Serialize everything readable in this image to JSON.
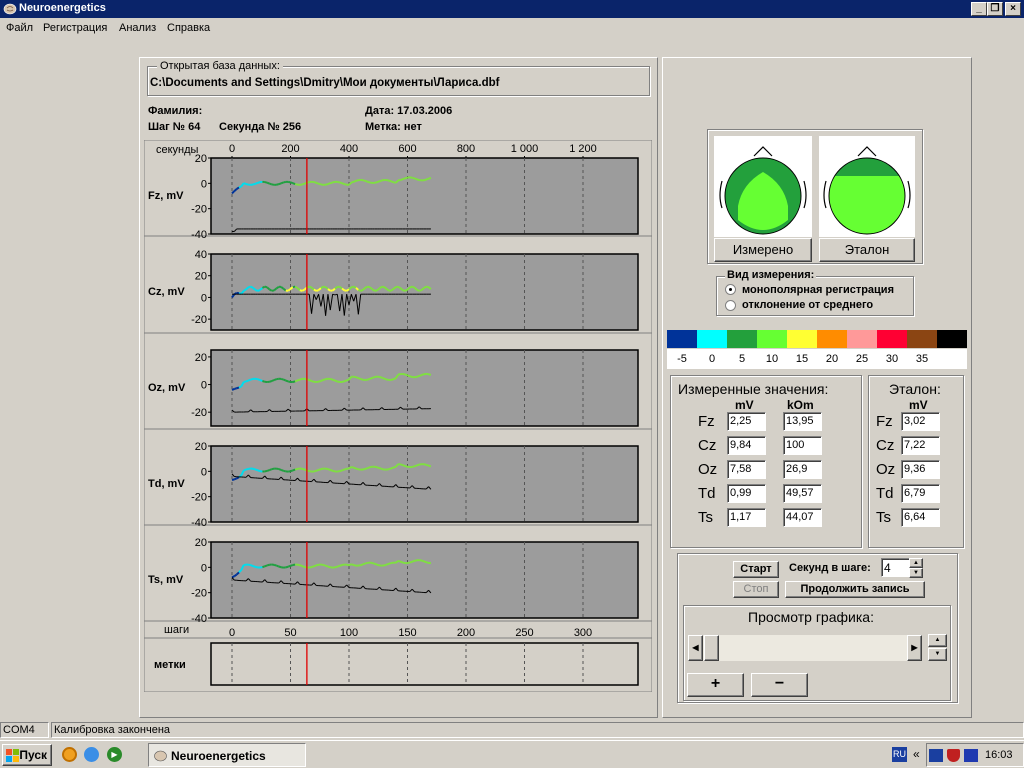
{
  "window": {
    "title": "Neuroenergetics",
    "min": "_",
    "max": "❐",
    "close": "×"
  },
  "menu": [
    "Файл",
    "Регистрация",
    "Анализ",
    "Справка"
  ],
  "database": {
    "label": "Открытая база данных:",
    "path": "C:\\Documents and Settings\\Dmitry\\Мои документы\\Лариса.dbf"
  },
  "info": {
    "surname": "Фамилия:",
    "step": "Шаг № 64",
    "second": "Секунда № 256",
    "date": "Дата: 17.03.2006",
    "mark": "Метка: нет"
  },
  "axis": {
    "top_label": "секунды",
    "top_ticks": [
      "0",
      "200",
      "400",
      "600",
      "800",
      "1 000",
      "1 200"
    ],
    "bottom_label": "шаги",
    "bottom_ticks": [
      "0",
      "50",
      "100",
      "150",
      "200",
      "250",
      "300"
    ]
  },
  "chart_data": [
    {
      "type": "line",
      "name": "Fz, mV",
      "yticks": [
        "20",
        "0",
        "-20",
        "-40"
      ],
      "ylim": [
        -40,
        20
      ],
      "xlim": [
        0,
        340
      ]
    },
    {
      "type": "line",
      "name": "Cz, mV",
      "yticks": [
        "40",
        "20",
        "0",
        "-20"
      ],
      "ylim": [
        -30,
        40
      ],
      "xlim": [
        0,
        340
      ]
    },
    {
      "type": "line",
      "name": "Oz, mV",
      "yticks": [
        "20",
        "0",
        "-20"
      ],
      "ylim": [
        -30,
        25
      ],
      "xlim": [
        0,
        340
      ]
    },
    {
      "type": "line",
      "name": "Td, mV",
      "yticks": [
        "20",
        "0",
        "-20",
        "-40"
      ],
      "ylim": [
        -40,
        20
      ],
      "xlim": [
        0,
        340
      ]
    },
    {
      "type": "line",
      "name": "Ts, mV",
      "yticks": [
        "20",
        "0",
        "-20",
        "-40"
      ],
      "ylim": [
        -40,
        20
      ],
      "xlim": [
        0,
        340
      ]
    }
  ],
  "marks_label": "метки",
  "heads": {
    "measured": "Измерено",
    "standard": "Эталон"
  },
  "view": {
    "label": "Вид измерения:",
    "options": [
      "монополярная регистрация",
      "отклонение от среднего"
    ],
    "selected": 0
  },
  "legend": {
    "colors": [
      "#003399",
      "#00ffff",
      "#23a03c",
      "#66ff33",
      "#ffff33",
      "#ff8c00",
      "#ff9999",
      "#ff0033",
      "#8b4513",
      "#000000"
    ],
    "labels": [
      "-5",
      "0",
      "5",
      "10",
      "15",
      "20",
      "25",
      "30",
      "35"
    ]
  },
  "measured": {
    "title": "Измеренные значения:",
    "col1": "mV",
    "col2": "kOm",
    "rows": [
      {
        "lead": "Fz",
        "mv": "2,25",
        "kom": "13,95"
      },
      {
        "lead": "Cz",
        "mv": "9,84",
        "kom": "100"
      },
      {
        "lead": "Oz",
        "mv": "7,58",
        "kom": "26,9"
      },
      {
        "lead": "Td",
        "mv": "0,99",
        "kom": "49,57"
      },
      {
        "lead": "Ts",
        "mv": "1,17",
        "kom": "44,07"
      }
    ]
  },
  "standard": {
    "title": "Эталон:",
    "col": "mV",
    "rows": [
      {
        "lead": "Fz",
        "mv": "3,02"
      },
      {
        "lead": "Cz",
        "mv": "7,22"
      },
      {
        "lead": "Oz",
        "mv": "9,36"
      },
      {
        "lead": "Td",
        "mv": "6,79"
      },
      {
        "lead": "Ts",
        "mv": "6,64"
      }
    ]
  },
  "controls": {
    "start": "Старт",
    "stop": "Стоп",
    "seconds_label": "Секунд в шаге:",
    "seconds_value": "4",
    "continue": "Продолжить запись",
    "preview": "Просмотр графика:",
    "plus": "+",
    "minus": "−"
  },
  "status": {
    "port": "COM4",
    "message": "Калибровка закончена"
  },
  "taskbar": {
    "start": "Пуск",
    "task": "Neuroenergetics",
    "lang": "RU",
    "chev": "«",
    "clock": "16:03"
  }
}
